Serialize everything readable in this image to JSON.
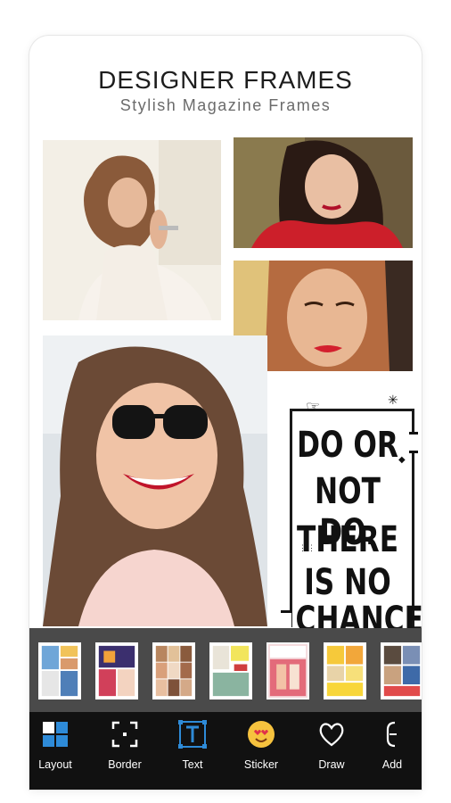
{
  "header": {
    "title": "DESIGNER FRAMES",
    "subtitle": "Stylish Magazine Frames"
  },
  "quote": {
    "lines": [
      "DO OR",
      "NOT DO.",
      "THERE",
      "IS NO",
      "CHANCE"
    ]
  },
  "layout_thumbnails": [
    {
      "name": "layout-1"
    },
    {
      "name": "layout-2"
    },
    {
      "name": "layout-3"
    },
    {
      "name": "layout-4"
    },
    {
      "name": "layout-5"
    },
    {
      "name": "layout-6"
    },
    {
      "name": "layout-7"
    }
  ],
  "toolbar": {
    "items": [
      {
        "label": "Layout",
        "icon": "layout-icon"
      },
      {
        "label": "Border",
        "icon": "border-icon"
      },
      {
        "label": "Text",
        "icon": "text-icon"
      },
      {
        "label": "Sticker",
        "icon": "sticker-icon"
      },
      {
        "label": "Draw",
        "icon": "heart-icon"
      },
      {
        "label": "Add",
        "icon": "add-icon"
      }
    ],
    "accent": "#2e8bd8"
  }
}
